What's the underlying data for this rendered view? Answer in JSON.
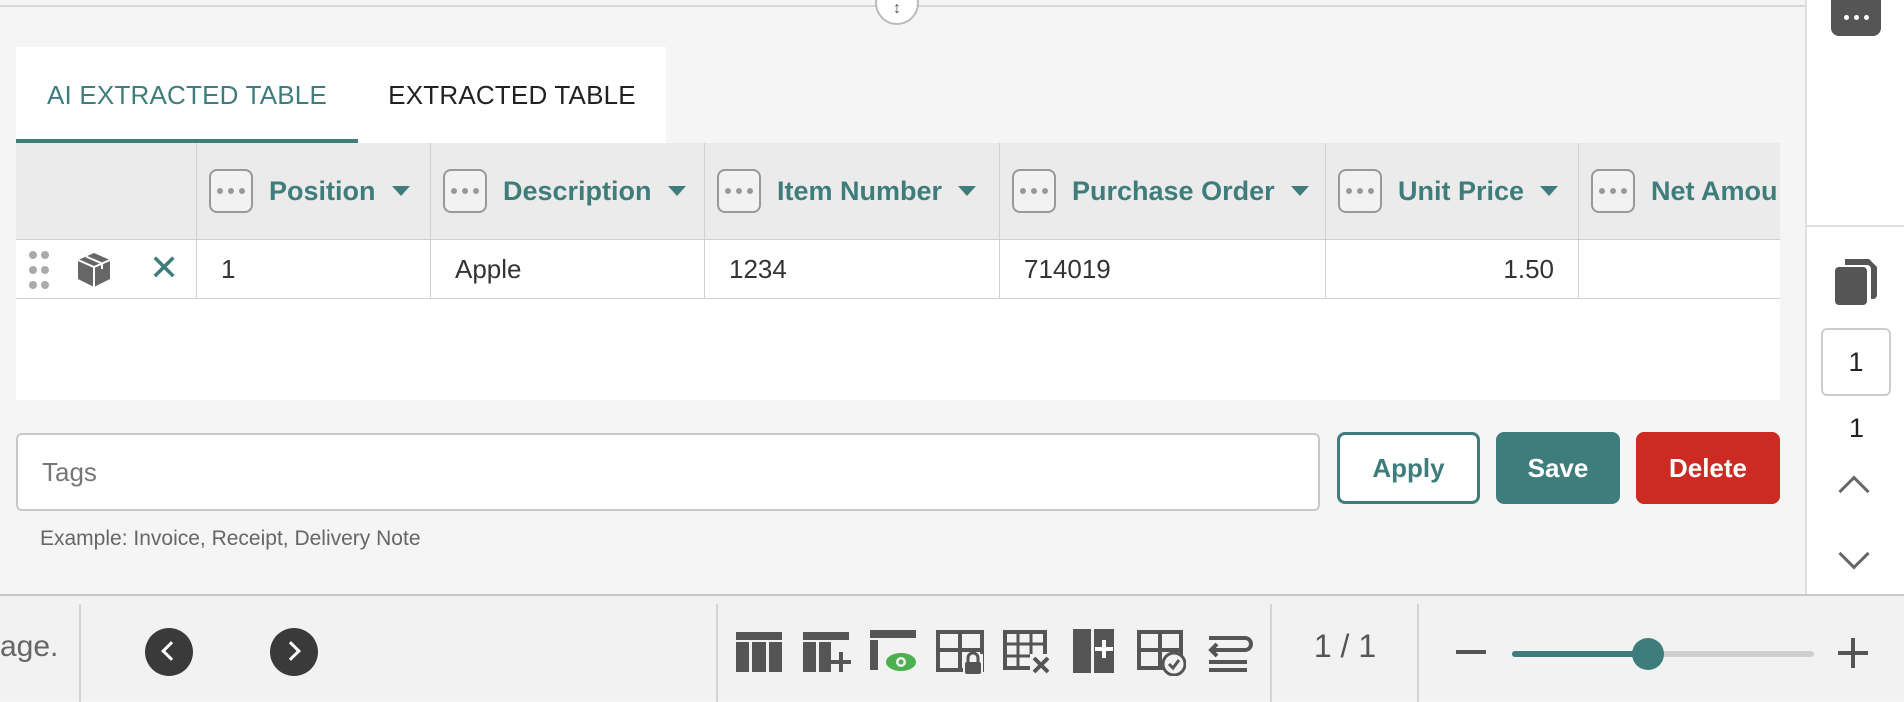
{
  "tabs": {
    "ai_extracted": "AI EXTRACTED TABLE",
    "extracted": "EXTRACTED TABLE"
  },
  "table": {
    "columns": [
      "Position",
      "Description",
      "Item Number",
      "Purchase Order",
      "Unit Price",
      "Net Amou"
    ],
    "rows": [
      {
        "position": "1",
        "description": "Apple",
        "item_number": "1234",
        "purchase_order": "714019",
        "unit_price": "1.50",
        "net_amount": ""
      }
    ]
  },
  "tags": {
    "placeholder": "Tags",
    "value": "",
    "hint": "Example: Invoice, Receipt, Delivery Note"
  },
  "actions": {
    "apply": "Apply",
    "save": "Save",
    "delete": "Delete"
  },
  "sidebar": {
    "current_page": "1",
    "total_pages": "1"
  },
  "footer": {
    "page_text_fragment": "age.",
    "page_count": "1 / 1",
    "zoom_level": 0.45
  },
  "colors": {
    "accent": "#3f7d7c",
    "danger": "#cc2a22"
  },
  "icons": [
    "resize-handle-icon",
    "more-icon",
    "drag-handle-icon",
    "box-icon",
    "delete-row-icon",
    "copy-icon",
    "chevron-up-icon",
    "chevron-down-icon",
    "previous-icon",
    "next-icon",
    "table-icon",
    "table-add-row-icon",
    "table-preview-icon",
    "table-lock-icon",
    "table-delete-icon",
    "add-column-icon",
    "table-check-icon",
    "wrap-icon",
    "zoom-out-icon",
    "zoom-in-icon"
  ]
}
